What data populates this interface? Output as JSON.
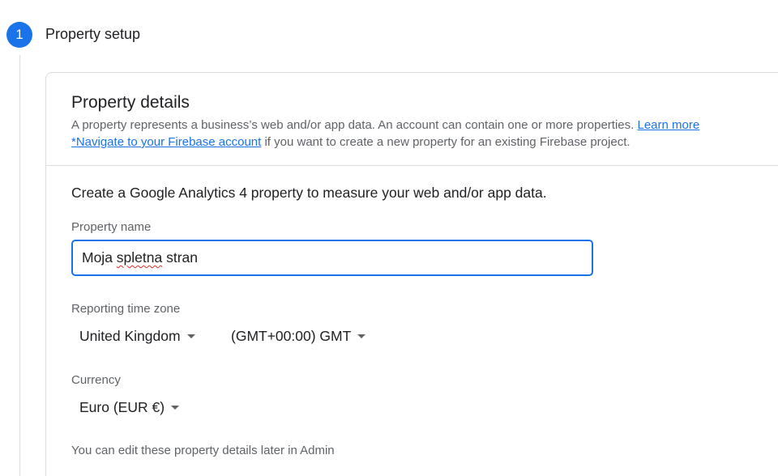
{
  "step": {
    "number": "1",
    "title": "Property setup"
  },
  "card": {
    "title": "Property details",
    "description_line1": "A property represents a business’s web and/or app data. An account can contain one or more properties.",
    "learn_more_link": "Learn more",
    "firebase_link": "*Navigate to your Firebase account",
    "description_line2_suffix": "if you want to create a new property for an existing Firebase project."
  },
  "form": {
    "intro": "Create a Google Analytics 4 property to measure your web and/or app data.",
    "property_name_label": "Property name",
    "property_name_value_prefix": "Moja ",
    "property_name_value_misspelled": "spletna",
    "property_name_value_suffix": " stran",
    "time_zone_label": "Reporting time zone",
    "country_value": "United Kingdom",
    "time_zone_value": "(GMT+00:00) GMT",
    "currency_label": "Currency",
    "currency_value": "Euro (EUR €)",
    "footnote": "You can edit these property details later in Admin"
  },
  "icons": {
    "dropdown_caret": "caret-down-icon"
  },
  "colors": {
    "accent": "#1a73e8",
    "text_primary": "#202124",
    "text_secondary": "#5f6368",
    "border": "#dadce0",
    "spellcheck": "#d93025"
  }
}
